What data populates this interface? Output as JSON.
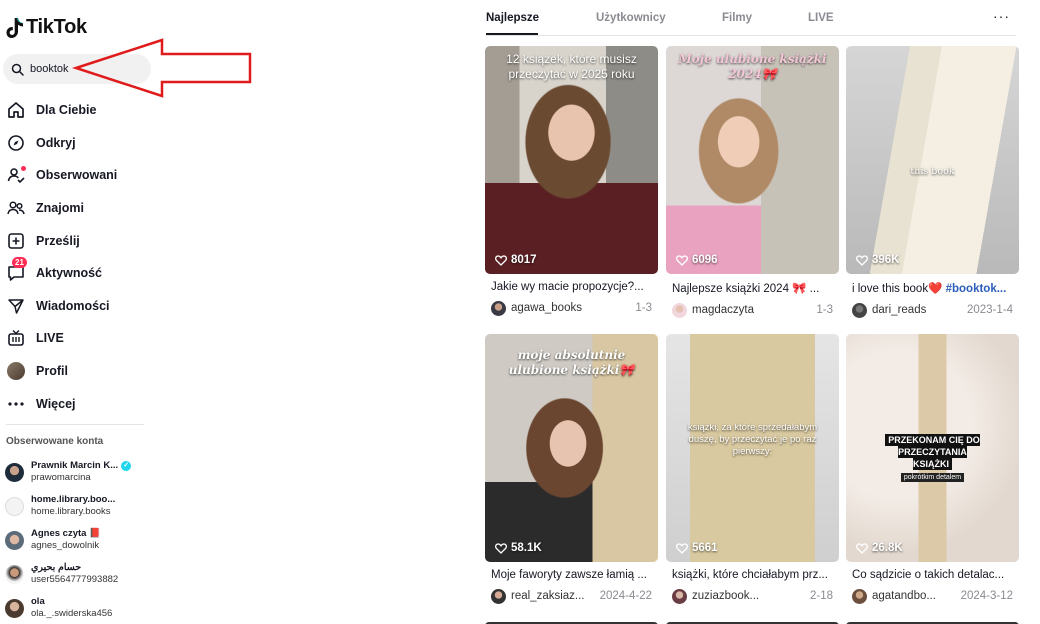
{
  "app": {
    "logo_text": "TikTok"
  },
  "search": {
    "value": "booktok"
  },
  "nav": [
    {
      "label": "Dla Ciebie"
    },
    {
      "label": "Odkryj"
    },
    {
      "label": "Obserwowani"
    },
    {
      "label": "Znajomi"
    },
    {
      "label": "Prześlij"
    },
    {
      "label": "Aktywność",
      "badge": "21"
    },
    {
      "label": "Wiadomości"
    },
    {
      "label": "LIVE"
    },
    {
      "label": "Profil"
    },
    {
      "label": "Więcej"
    }
  ],
  "followed": {
    "title": "Obserwowane konta",
    "accounts": [
      {
        "name": "Prawnik Marcin K...",
        "handle": "prawomarcina",
        "verified": true
      },
      {
        "name": "home.library.boo...",
        "handle": "home.library.books"
      },
      {
        "name": "Agnes czyta 📕",
        "handle": "agnes_dowolnik"
      },
      {
        "name": "حسام بحيري",
        "handle": "user5564777993882"
      },
      {
        "name": "ola",
        "handle": "ola._.swiderska456"
      }
    ]
  },
  "tabs": [
    {
      "label": "Najlepsze",
      "active": true
    },
    {
      "label": "Użytkownicy"
    },
    {
      "label": "Filmy"
    },
    {
      "label": "LIVE"
    }
  ],
  "more_label": "···",
  "videos": [
    {
      "overlay": "12 książek, które musisz przeczytać w 2025 roku",
      "likes": "8017",
      "caption": "Jakie wy macie propozycje?...",
      "user": "agawa_books",
      "date": "1-3"
    },
    {
      "overlay": "Moje ulubione książki 2024🎀",
      "likes": "6096",
      "caption": "Najlepsze książki 2024 🎀 ...",
      "user": "magdaczyta",
      "date": "1-3"
    },
    {
      "overlay": "this book",
      "likes": "396K",
      "caption": "i love this book❤️ ",
      "caption_tag": "#booktok...",
      "user": "dari_reads",
      "date": "2023-1-4"
    },
    {
      "overlay": "moje absolutnie ulubione książki🎀",
      "likes": "58.1K",
      "caption": "Moje faworyty zawsze łamią ...",
      "user": "real_zaksiaz...",
      "date": "2024-4-22"
    },
    {
      "overlay": "książki, za które sprzedałabym duszę, by przeczytać je po raz pierwszy:",
      "likes": "5661",
      "caption": "książki, które chciałabym prz...",
      "user": "zuziazbook...",
      "date": "2-18"
    },
    {
      "overlay": "PRZEKONAM CIĘ DO PRZECZYTANIA KSIĄŻKI",
      "overlay_small": "pokrótkim detalem",
      "likes": "26.8K",
      "caption": "Co sądzicie o takich detalac...",
      "user": "agatandbo...",
      "date": "2024-3-12"
    }
  ],
  "colors": {
    "accent": "#fe2c55",
    "arrow": "#e01b1b",
    "link": "#2b5db9"
  }
}
